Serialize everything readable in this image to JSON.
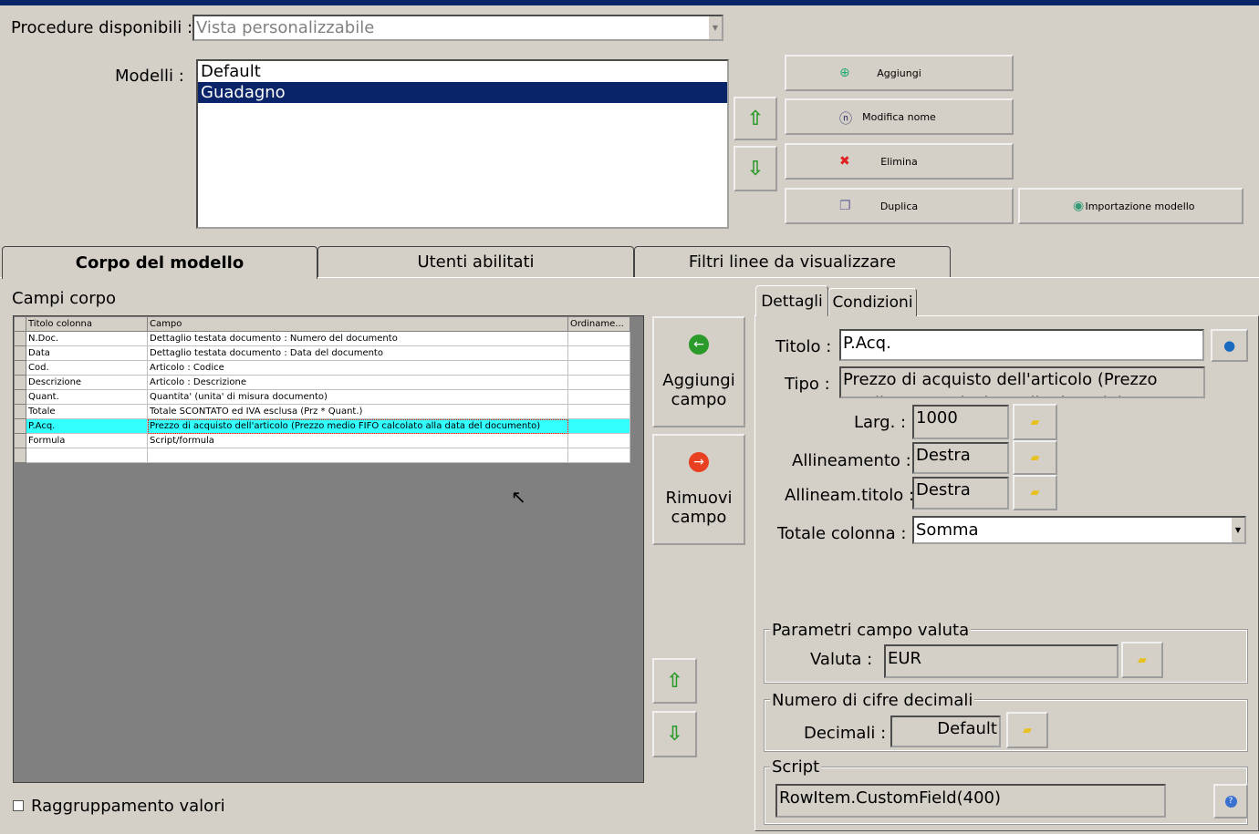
{
  "procedure": {
    "label": "Procedure disponibili :",
    "value": "Vista personalizzabile"
  },
  "modelli": {
    "label": "Modelli :",
    "items": [
      "Default",
      "Guadagno"
    ],
    "selected": "Guadagno"
  },
  "buttons": {
    "aggiungi": "Aggiungi",
    "modifica": "Modifica nome",
    "elimina": "Elimina",
    "duplica": "Duplica",
    "importazione": "Importazione modello"
  },
  "tabs": [
    "Corpo del modello",
    "Utenti abilitati",
    "Filtri linee da visualizzare"
  ],
  "campi": {
    "label": "Campi corpo",
    "columns": [
      "Titolo colonna",
      "Campo",
      "Ordiname..."
    ],
    "rows": [
      {
        "titolo": "N.Doc.",
        "campo": "Dettaglio testata documento : Numero del documento"
      },
      {
        "titolo": "Data",
        "campo": "Dettaglio testata documento : Data del documento"
      },
      {
        "titolo": "Cod.",
        "campo": "Articolo : Codice"
      },
      {
        "titolo": "Descrizione",
        "campo": "Articolo : Descrizione"
      },
      {
        "titolo": "Quant.",
        "campo": "Quantita' (unita' di misura documento)"
      },
      {
        "titolo": "Totale",
        "campo": "Totale SCONTATO ed IVA esclusa (Prz * Quant.)"
      },
      {
        "titolo": "P.Acq.",
        "campo": "Prezzo di acquisto dell'articolo (Prezzo medio FIFO calcolato alla data del documento)"
      },
      {
        "titolo": "Formula",
        "campo": "Script/formula"
      },
      {
        "titolo": "",
        "campo": ""
      }
    ],
    "selected_index": 6,
    "aggiungi_campo": "Aggiungi campo",
    "rimuovi_campo": "Rimuovi campo",
    "raggruppamento": "Raggruppamento valori"
  },
  "details": {
    "tabs": [
      "Dettagli",
      "Condizioni"
    ],
    "titolo_label": "Titolo :",
    "titolo": "P.Acq.",
    "tipo_label": "Tipo :",
    "tipo": "Prezzo di acquisto dell'articolo (Prezzo medio FIFO calcolato alla data del documento)",
    "larg_label": "Larg. :",
    "larg": "1000",
    "allineamento_label": "Allineamento :",
    "allineamento": "Destra",
    "allineam_titolo_label": "Allineam.titolo :",
    "allineam_titolo": "Destra",
    "totale_label": "Totale colonna :",
    "totale": "Somma",
    "valuta_group": "Parametri campo valuta",
    "valuta_label": "Valuta :",
    "valuta": "EUR",
    "decimali_group": "Numero di cifre decimali",
    "decimali_label": "Decimali :",
    "decimali": "Default",
    "script_group": "Script",
    "script": "RowItem.CustomField(400)"
  }
}
